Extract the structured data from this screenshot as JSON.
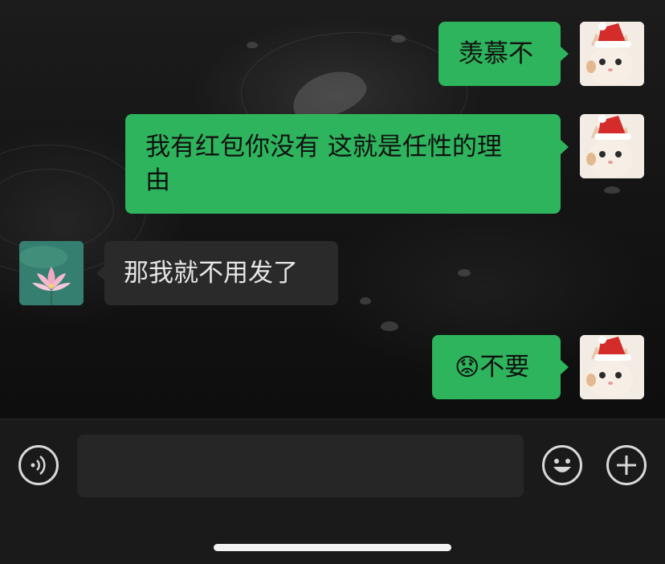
{
  "conversation": {
    "messages": [
      {
        "sender": "me",
        "avatar": "cat-with-santa-hat",
        "text": "羡慕不"
      },
      {
        "sender": "me",
        "avatar": "cat-with-santa-hat",
        "line1": "我有红包你没有 这就是任性的理",
        "line2": "由"
      },
      {
        "sender": "other",
        "avatar": "lotus-flower",
        "text": "那我就不用发了"
      },
      {
        "sender": "me",
        "avatar": "cat-with-santa-hat",
        "emoji": "😟",
        "text": "不要"
      }
    ]
  },
  "input_bar": {
    "voice_icon": "voice-icon",
    "emoji_icon": "emoji-icon",
    "plus_icon": "plus-icon",
    "text_value": ""
  },
  "colors": {
    "my_bubble": "#2db45c",
    "their_bubble": "#2a2a2a",
    "background": "#111111"
  }
}
